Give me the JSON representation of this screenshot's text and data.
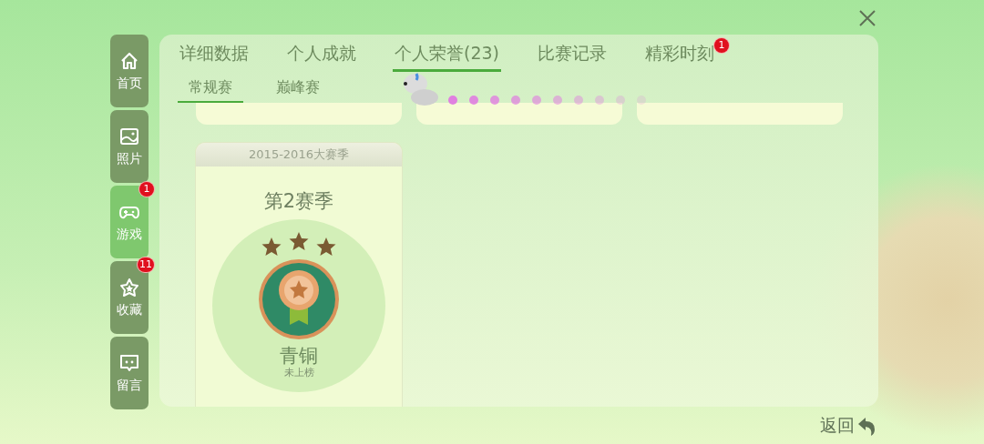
{
  "sidebar": {
    "items": [
      {
        "label": "首页",
        "selected": false
      },
      {
        "label": "照片",
        "selected": false
      },
      {
        "label": "游戏",
        "selected": true,
        "badge": "1"
      },
      {
        "label": "收藏",
        "selected": false,
        "badge": "11"
      },
      {
        "label": "留言",
        "selected": false
      }
    ]
  },
  "tabs": [
    {
      "label": "详细数据",
      "selected": false
    },
    {
      "label": "个人成就",
      "selected": false
    },
    {
      "label": "个人荣誉(23)",
      "selected": true
    },
    {
      "label": "比赛记录",
      "selected": false
    },
    {
      "label": "精彩时刻",
      "selected": false,
      "badge": "1"
    }
  ],
  "subtabs": [
    {
      "label": "常规赛",
      "selected": true
    },
    {
      "label": "巅峰赛",
      "selected": false
    }
  ],
  "seasons": [
    {
      "header": "2015-2016大赛季",
      "title": "第2赛季",
      "stars": 3,
      "rank": "青铜",
      "status": "未上榜"
    }
  ],
  "back_button": {
    "label": "返回"
  }
}
